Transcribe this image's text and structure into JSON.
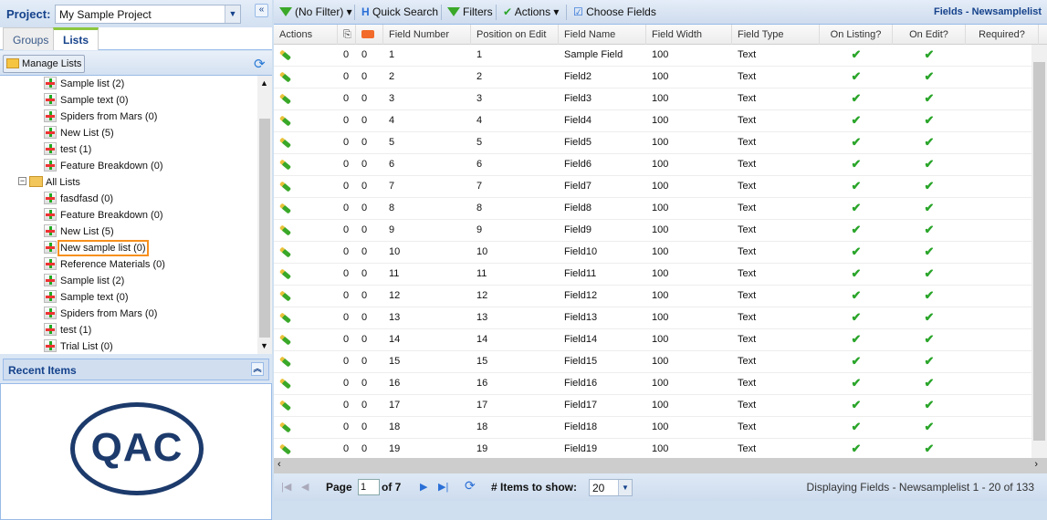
{
  "project": {
    "label": "Project:",
    "value": "My Sample Project"
  },
  "tabs": [
    "Groups",
    "Lists"
  ],
  "manage_lists": "Manage Lists",
  "tree": {
    "items_top": [
      "Sample list (2)",
      "Sample text (0)",
      "Spiders from Mars (0)",
      "New List (5)",
      "test (1)",
      "Feature Breakdown (0)"
    ],
    "all_lists": "All Lists",
    "items_all": [
      "fasdfasd (0)",
      "Feature Breakdown (0)",
      "New List (5)",
      "New sample list (0)",
      "Reference Materials (0)",
      "Sample list (2)",
      "Sample text (0)",
      "Spiders from Mars (0)",
      "test (1)",
      "Trial List (0)"
    ],
    "highlighted": "New sample list (0)"
  },
  "recent_items": "Recent Items",
  "logo_text": "QAC",
  "toolbar": {
    "filter": "(No Filter)",
    "quick_search": "Quick Search",
    "filters": "Filters",
    "actions": "Actions",
    "choose_fields": "Choose Fields",
    "title": "Fields - Newsamplelist"
  },
  "columns": [
    "Actions",
    "",
    "",
    "Field Number",
    "Position on Edit",
    "Field Name",
    "Field Width",
    "Field Type",
    "On Listing?",
    "On Edit?",
    "Required?"
  ],
  "rows": [
    {
      "n": "1",
      "p": "1",
      "name": "Sample Field"
    },
    {
      "n": "2",
      "p": "2",
      "name": "Field2"
    },
    {
      "n": "3",
      "p": "3",
      "name": "Field3"
    },
    {
      "n": "4",
      "p": "4",
      "name": "Field4"
    },
    {
      "n": "5",
      "p": "5",
      "name": "Field5"
    },
    {
      "n": "6",
      "p": "6",
      "name": "Field6"
    },
    {
      "n": "7",
      "p": "7",
      "name": "Field7"
    },
    {
      "n": "8",
      "p": "8",
      "name": "Field8"
    },
    {
      "n": "9",
      "p": "9",
      "name": "Field9"
    },
    {
      "n": "10",
      "p": "10",
      "name": "Field10"
    },
    {
      "n": "11",
      "p": "11",
      "name": "Field11"
    },
    {
      "n": "12",
      "p": "12",
      "name": "Field12"
    },
    {
      "n": "13",
      "p": "13",
      "name": "Field13"
    },
    {
      "n": "14",
      "p": "14",
      "name": "Field14"
    },
    {
      "n": "15",
      "p": "15",
      "name": "Field15"
    },
    {
      "n": "16",
      "p": "16",
      "name": "Field16"
    },
    {
      "n": "17",
      "p": "17",
      "name": "Field17"
    },
    {
      "n": "18",
      "p": "18",
      "name": "Field18"
    },
    {
      "n": "19",
      "p": "19",
      "name": "Field19"
    }
  ],
  "row_defaults": {
    "attachments": "0",
    "comments": "0",
    "width": "100",
    "type": "Text"
  },
  "pager": {
    "page_label": "Page",
    "page": "1",
    "of": "of 7",
    "items_label": "# Items to show:",
    "items": "20",
    "status": "Displaying Fields - Newsamplelist 1 - 20 of 133"
  }
}
